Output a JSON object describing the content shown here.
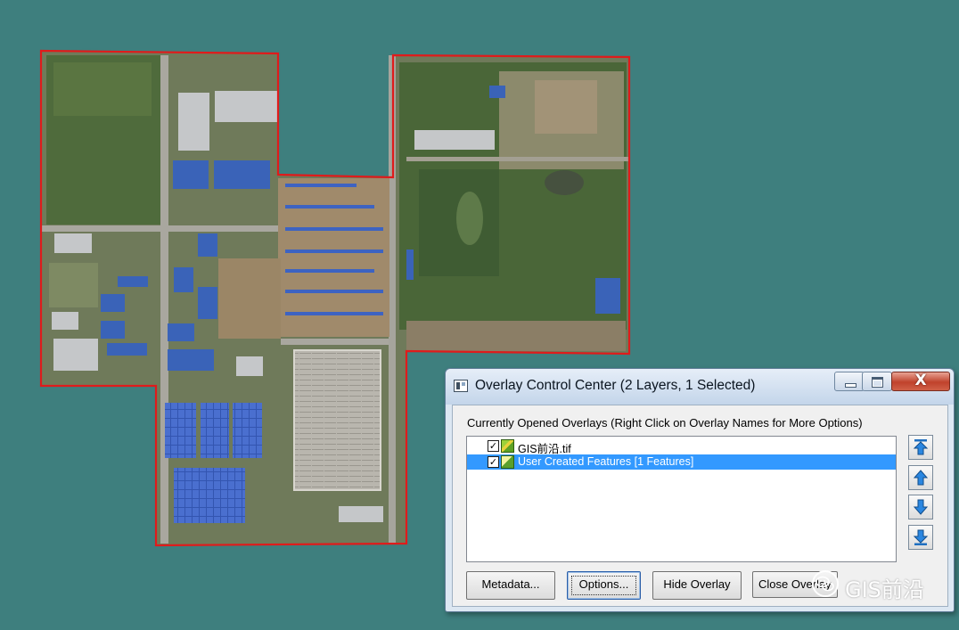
{
  "dialog": {
    "title": "Overlay Control Center (2 Layers, 1 Selected)",
    "close_glyph": "X",
    "instruction": "Currently Opened Overlays (Right Click on Overlay Names for More Options)",
    "overlays": [
      {
        "name": "GIS前沿.tif",
        "checked": true,
        "selected": false,
        "icon": "raster-layer-icon"
      },
      {
        "name": "User Created Features [1 Features]",
        "checked": true,
        "selected": true,
        "icon": "vector-features-icon"
      }
    ],
    "check_glyph": "✓",
    "order_buttons": [
      "move-to-top-icon",
      "move-up-icon",
      "move-down-icon",
      "move-to-bottom-icon"
    ],
    "buttons": {
      "metadata": "Metadata...",
      "options": "Options...",
      "hide": "Hide Overlay",
      "close": "Close Overlay"
    }
  },
  "watermark": {
    "text": "GIS前沿"
  },
  "colors": {
    "background": "#3e7f7e",
    "boundary": "#e01b1b",
    "selection": "#3399ff",
    "roof_blue": "#3a63b8"
  }
}
